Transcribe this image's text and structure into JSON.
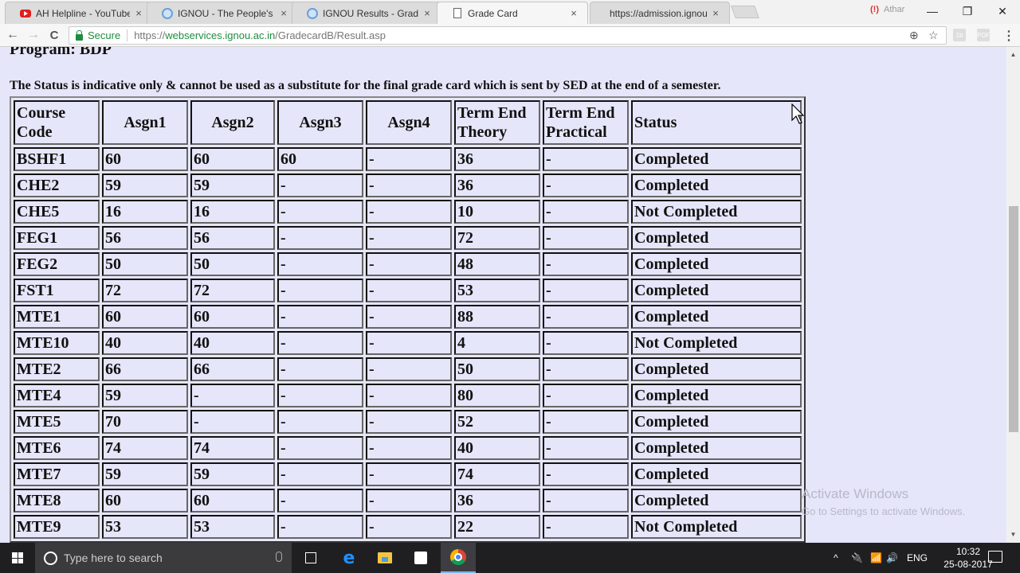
{
  "browser": {
    "tabs": [
      {
        "title": "AH Helpline - YouTube",
        "icon": "youtube-icon",
        "active": false
      },
      {
        "title": "IGNOU - The People's Ur",
        "icon": "ignou-logo-icon",
        "active": false
      },
      {
        "title": "IGNOU Results - Grade C",
        "icon": "ignou-logo-icon",
        "active": false
      },
      {
        "title": "Grade Card",
        "icon": "document-icon",
        "active": true
      },
      {
        "title": "https://admission.ignou.",
        "icon": "none",
        "active": false
      }
    ],
    "tab_close_glyph": "×",
    "profile": {
      "alert_glyph": "(!)",
      "name": "Athar"
    },
    "window_controls": {
      "minimize": "—",
      "restore": "❐",
      "close": "✕"
    },
    "nav": {
      "back": "←",
      "forward": "→",
      "reload": "C"
    },
    "address": {
      "security_label": "Secure",
      "scheme": "https://",
      "host": "webservices.ignou.ac.in",
      "path": "/GradecardB/Result.asp"
    },
    "omnibox_icons": {
      "zoom": "⊕",
      "star": "☆"
    },
    "extensions": [
      "1b",
      "PDF"
    ],
    "menu_glyph": "⋮"
  },
  "page": {
    "program_label": "Program: BDP",
    "notice": "The Status is indicative only & cannot be used as a substitute for the final grade card which is sent by SED at the end of a semester.",
    "table": {
      "headers": [
        "Course Code",
        "Asgn1",
        "Asgn2",
        "Asgn3",
        "Asgn4",
        "Term End Theory",
        "Term End Practical",
        "Status"
      ],
      "rows": [
        [
          "BSHF1",
          "60",
          "60",
          "60",
          "-",
          "36",
          "-",
          "Completed"
        ],
        [
          "CHE2",
          "59",
          "59",
          "-",
          "-",
          "36",
          "-",
          "Completed"
        ],
        [
          "CHE5",
          "16",
          "16",
          "-",
          "-",
          "10",
          "-",
          "Not Completed"
        ],
        [
          "FEG1",
          "56",
          "56",
          "-",
          "-",
          "72",
          "-",
          "Completed"
        ],
        [
          "FEG2",
          "50",
          "50",
          "-",
          "-",
          "48",
          "-",
          "Completed"
        ],
        [
          "FST1",
          "72",
          "72",
          "-",
          "-",
          "53",
          "-",
          "Completed"
        ],
        [
          "MTE1",
          "60",
          "60",
          "-",
          "-",
          "88",
          "-",
          "Completed"
        ],
        [
          "MTE10",
          "40",
          "40",
          "-",
          "-",
          "4",
          "-",
          "Not Completed"
        ],
        [
          "MTE2",
          "66",
          "66",
          "-",
          "-",
          "50",
          "-",
          "Completed"
        ],
        [
          "MTE4",
          "59",
          "-",
          "-",
          "-",
          "80",
          "-",
          "Completed"
        ],
        [
          "MTE5",
          "70",
          "-",
          "-",
          "-",
          "52",
          "-",
          "Completed"
        ],
        [
          "MTE6",
          "74",
          "74",
          "-",
          "-",
          "40",
          "-",
          "Completed"
        ],
        [
          "MTE7",
          "59",
          "59",
          "-",
          "-",
          "74",
          "-",
          "Completed"
        ],
        [
          "MTE8",
          "60",
          "60",
          "-",
          "-",
          "36",
          "-",
          "Completed"
        ],
        [
          "MTE9",
          "53",
          "53",
          "-",
          "-",
          "22",
          "-",
          "Not Completed"
        ]
      ]
    },
    "watermark": {
      "title": "Activate Windows",
      "subtitle": "Go to Settings to activate Windows."
    },
    "colors": {
      "page_background": "#e6e6fa",
      "secure_green": "#1e8e3e"
    }
  },
  "taskbar": {
    "search_placeholder": "Type here to search",
    "tray": {
      "chevron": "^",
      "language": "ENG",
      "time": "10:32",
      "date": "25-08-2017"
    }
  }
}
